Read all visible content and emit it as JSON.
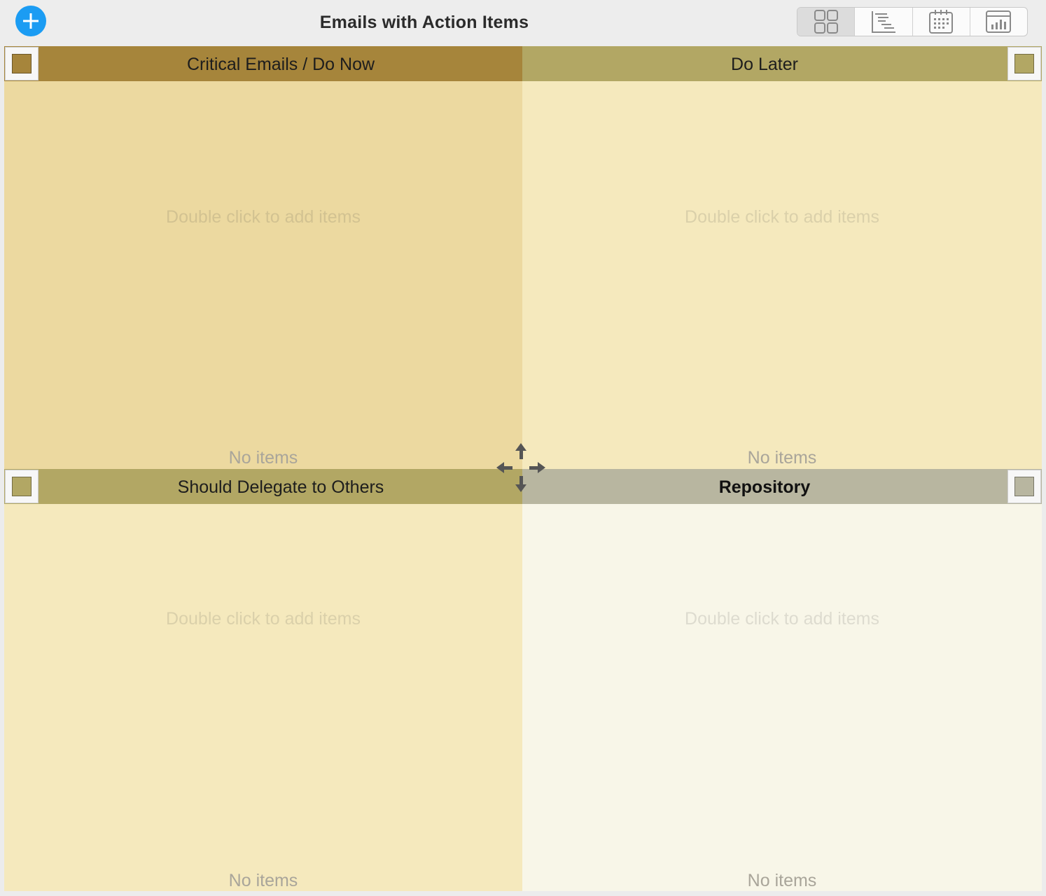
{
  "toolbar": {
    "title": "Emails with Action Items",
    "add_icon": "plus-circle-icon",
    "accent_color": "#1b9cf3",
    "views": [
      {
        "icon": "grid-view-icon",
        "selected": true
      },
      {
        "icon": "outline-view-icon",
        "selected": false
      },
      {
        "icon": "calendar-view-icon",
        "selected": false
      },
      {
        "icon": "chart-view-icon",
        "selected": false
      }
    ]
  },
  "quadrants": {
    "top_left": {
      "title": "Critical Emails / Do Now",
      "hint": "Double click to add items",
      "empty_text": "No items",
      "header_color": "#a6853b",
      "body_color": "#ecd9a0"
    },
    "top_right": {
      "title": "Do Later",
      "hint": "Double click to add items",
      "empty_text": "No items",
      "header_color": "#b2a764",
      "body_color": "#f5e9bd"
    },
    "bottom_left": {
      "title": "Should Delegate to Others",
      "hint": "Double click to add items",
      "empty_text": "No items",
      "header_color": "#b2a764",
      "body_color": "#f5e9bd"
    },
    "bottom_right": {
      "title": "Repository",
      "hint": "Double click to add items",
      "empty_text": "No items",
      "header_color": "#b8b6a0",
      "body_color": "#f8f6e8"
    }
  },
  "move_handle_icon": "move-arrows-icon"
}
